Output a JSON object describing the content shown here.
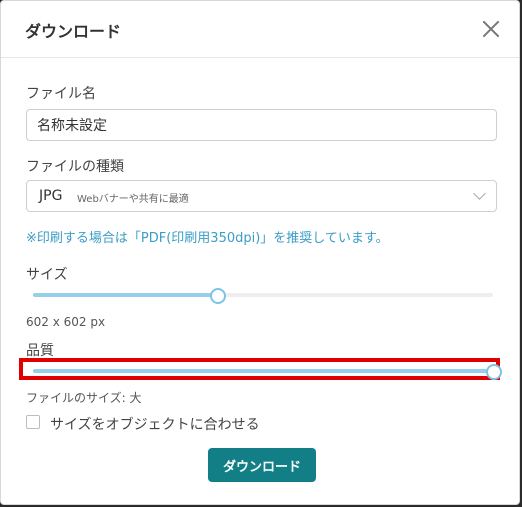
{
  "dialog": {
    "title": "ダウンロード"
  },
  "filename": {
    "label": "ファイル名",
    "value": "名称未設定"
  },
  "filetype": {
    "label": "ファイルの種類",
    "selected": "JPG",
    "description": "Webバナーや共有に最適"
  },
  "note": "※印刷する場合は「PDF(印刷用350dpi)」を推奨しています。",
  "size": {
    "label": "サイズ",
    "slider_value_percent": 40,
    "readout": "602 x 602 px"
  },
  "quality": {
    "label": "品質",
    "slider_value_percent": 100,
    "readout": "ファイルのサイズ: 大"
  },
  "fit_to_object": {
    "label": "サイズをオブジェクトに合わせる",
    "checked": false
  },
  "download_button": {
    "label": "ダウンロード"
  },
  "colors": {
    "primary_button": "#127f86",
    "link_note": "#3a9dc6",
    "slider_fill": "#95d0ea",
    "highlight_border": "#e00000"
  }
}
